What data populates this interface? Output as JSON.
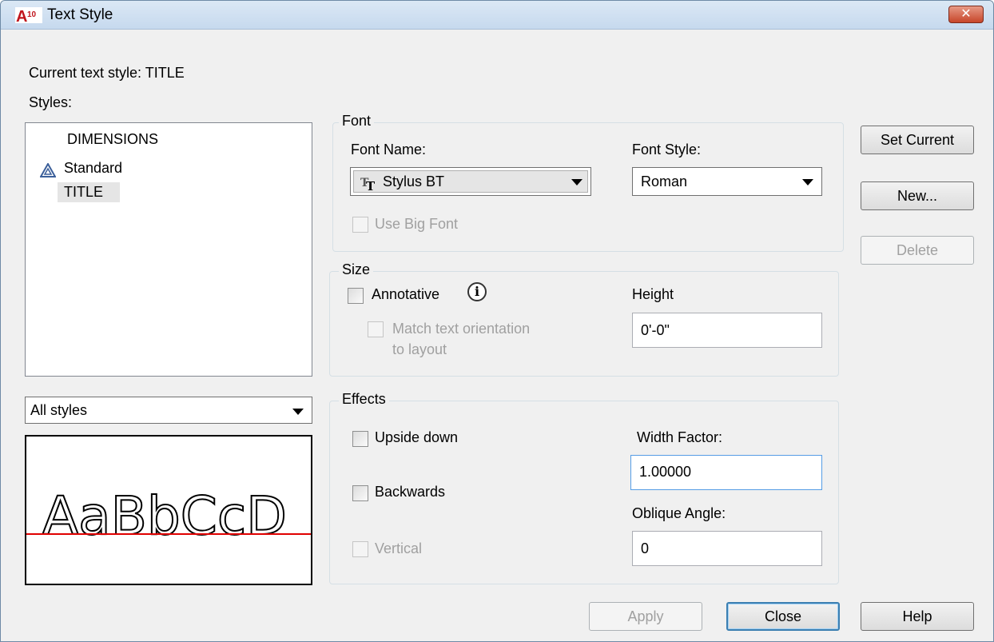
{
  "window": {
    "title": "Text Style",
    "close_label": "✕"
  },
  "current_style": {
    "label": "Current text style:",
    "value": "TITLE"
  },
  "styles": {
    "label": "Styles:",
    "items": [
      "DIMENSIONS",
      "Standard",
      "TITLE"
    ],
    "selected": "TITLE",
    "filter_value": "All styles"
  },
  "preview": {
    "sample_text": "AaBbCcD",
    "baseline_color": "#e00000"
  },
  "font": {
    "group_label": "Font",
    "font_name_label": "Font Name:",
    "font_name_value": "Stylus BT",
    "font_style_label": "Font Style:",
    "font_style_value": "Roman",
    "big_font_label": "Use Big Font"
  },
  "size": {
    "group_label": "Size",
    "annotative_label": "Annotative",
    "match_label_line1": "Match text orientation",
    "match_label_line2": "to layout",
    "height_label": "Height",
    "height_value": "0'-0\""
  },
  "effects": {
    "group_label": "Effects",
    "upside_down_label": "Upside down",
    "backwards_label": "Backwards",
    "vertical_label": "Vertical",
    "width_factor_label": "Width Factor:",
    "width_factor_value": "1.00000",
    "oblique_label": "Oblique Angle:",
    "oblique_value": "0"
  },
  "buttons": {
    "set_current": "Set Current",
    "new": "New...",
    "delete": "Delete",
    "apply": "Apply",
    "close": "Close",
    "help": "Help"
  },
  "icons": {
    "app": "autocad-a10-icon",
    "annotative": "annotative-triangle-icon",
    "truetype": "truetype-font-icon",
    "info": "info-icon"
  }
}
